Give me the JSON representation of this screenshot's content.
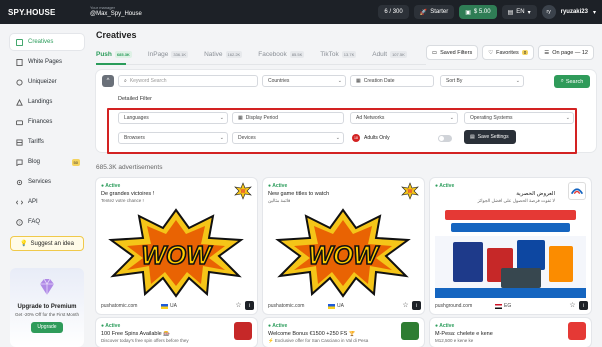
{
  "header": {
    "logo": "SPY.HOUSE",
    "manager_label": "Your manager",
    "manager_handle": "@Max_Spy_House",
    "usage": "6 / 300",
    "plan": "Starter",
    "balance": "$ 5.00",
    "lang": "EN",
    "avatar": "ry",
    "username": "ryuzaki23"
  },
  "sidebar": {
    "items": [
      {
        "label": "Creatives",
        "icon": "creatives-icon",
        "active": true
      },
      {
        "label": "White Pages",
        "icon": "white-pages-icon"
      },
      {
        "label": "Uniqueizer",
        "icon": "uniqueizer-icon"
      },
      {
        "label": "Landings",
        "icon": "landings-icon"
      },
      {
        "label": "Finances",
        "icon": "finances-icon"
      },
      {
        "label": "Tariffs",
        "icon": "tariffs-icon"
      },
      {
        "label": "Blog",
        "icon": "blog-icon",
        "badge": "50"
      },
      {
        "label": "Services",
        "icon": "services-icon"
      },
      {
        "label": "API",
        "icon": "api-icon"
      },
      {
        "label": "FAQ",
        "icon": "faq-icon"
      }
    ],
    "suggest": "Suggest an idea",
    "promo_title": "Upgrade to Premium",
    "promo_text": "Get -20% Off for the First Month",
    "promo_button": "Upgrade"
  },
  "main": {
    "title": "Creatives",
    "tabs": [
      {
        "label": "Push",
        "count": "685.3K"
      },
      {
        "label": "InPage",
        "count": "336.1K"
      },
      {
        "label": "Native",
        "count": "162.2K"
      },
      {
        "label": "Facebook",
        "count": "85.5K"
      },
      {
        "label": "TikTok",
        "count": "13.7K"
      },
      {
        "label": "Adult",
        "count": "107.5K"
      }
    ],
    "saved_filters": "Saved Filters",
    "favorites": "Favorites",
    "favorites_count": "0",
    "on_page": "On page — 12",
    "keyword_placeholder": "Keyword Search",
    "countries": "Countries",
    "creation_date": "Creation Date",
    "sort_by": "Sort By",
    "search": "Search",
    "detailed_filter": "Detailed Filter",
    "languages": "Languages",
    "display_period": "Display Period",
    "ad_networks": "Ad Networks",
    "operating_systems": "Operating Systems",
    "browsers": "Browsers",
    "devices": "Devices",
    "adults_only": "Adults Only",
    "save_settings": "Save Settings",
    "adv_count": "685.3K  advertisements"
  },
  "cards": [
    {
      "status": "Active",
      "title": "De grandes victoires !",
      "desc": "Tentez votre chance !",
      "domain": "pushatomic.com",
      "geo": "UA"
    },
    {
      "status": "Active",
      "title": "New game titles to watch",
      "desc": "قائمة مثالين",
      "domain": "pushatomic.com",
      "geo": "UA"
    },
    {
      "status": "Active",
      "title": "العروض الحصرية",
      "desc": "لا تفوت فرصة الحصول على أفضل الجوائز",
      "domain": "pushground.com",
      "geo": "EG"
    },
    {
      "status": "Active",
      "title": "100 Free Spins Available 🎰",
      "desc": "Discover today's free spin offers before they"
    },
    {
      "status": "Active",
      "title": "Welcome Bonus €1500 +250 FS 🏆",
      "desc": "⚡ Exclusive offer for San Casciano in Val di Pesa"
    },
    {
      "status": "Active",
      "title": "M-Pesa: chelete e kene",
      "desc": "M12,500 e kene ke"
    }
  ],
  "colors": {
    "accent": "#2a9c5a",
    "dark": "#1d2127",
    "highlight": "#d32222"
  }
}
